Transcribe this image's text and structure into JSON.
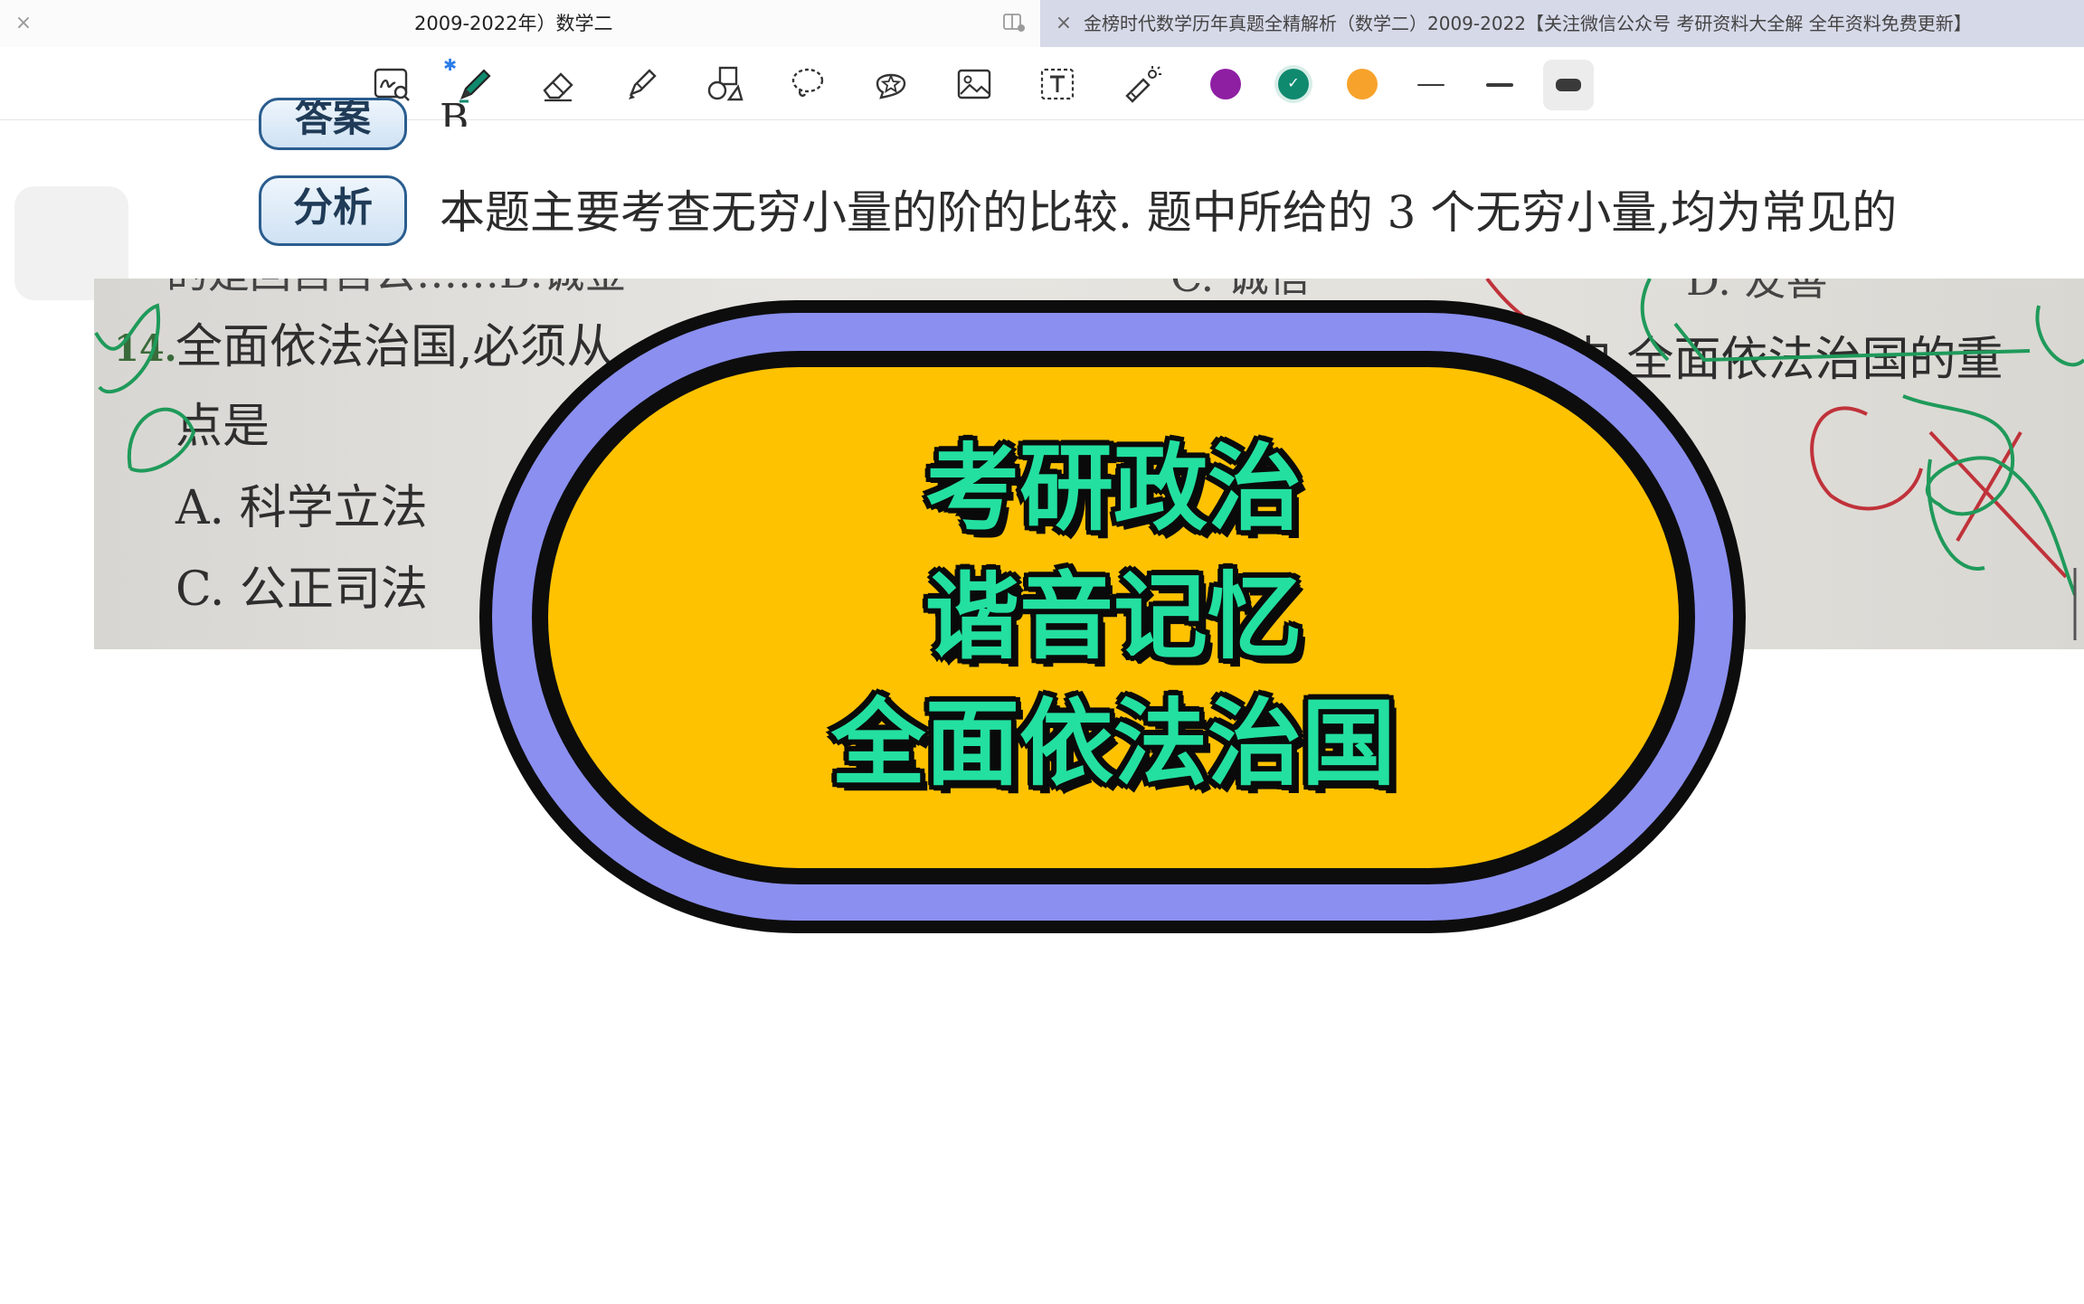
{
  "tabs": {
    "left": {
      "close": "×",
      "title": "2009-2022年）数学二"
    },
    "right": {
      "close": "×",
      "title": "金榜时代数学历年真题全精解析（数学二）2009-2022【关注微信公众号 考研资料大全解 全年资料免费更新】"
    }
  },
  "toolbar": {
    "bluetooth": "✱",
    "tools": [
      "zoom-edit-icon",
      "pen-icon",
      "eraser-icon",
      "highlighter-icon",
      "shapes-icon",
      "lasso-icon",
      "sticker-icon",
      "image-icon",
      "text-box-icon",
      "laser-pointer-icon"
    ],
    "colors": [
      "#8e1fa3",
      "#0f8a6f",
      "#f7a22b"
    ],
    "selected_color": "#0f8a6f",
    "check": "✓",
    "selected_width": "thick"
  },
  "document": {
    "answer_badge": "答案",
    "answer_text": "B.",
    "analysis_badge": "分析",
    "analysis_text": "本题主要考查无穷小量的阶的比较. 题中所给的 3 个无穷小量,均为常见的",
    "photo": {
      "top_cut_line": "的是回自自公……B.诚金",
      "top_cut_c": "C. 诚信",
      "top_cut_d": "D. 友善",
      "question_number": "14.",
      "question_line1": "全面依法治国,必须从",
      "question_line1_end": "中,全面依法治国的重",
      "question_line2": "点是",
      "option_a": "A. 科学立法",
      "option_c": "C. 公正司法"
    }
  },
  "overlay": {
    "line1": "考研政治",
    "line2": "谐音记忆",
    "line3": "全面依法治国"
  }
}
